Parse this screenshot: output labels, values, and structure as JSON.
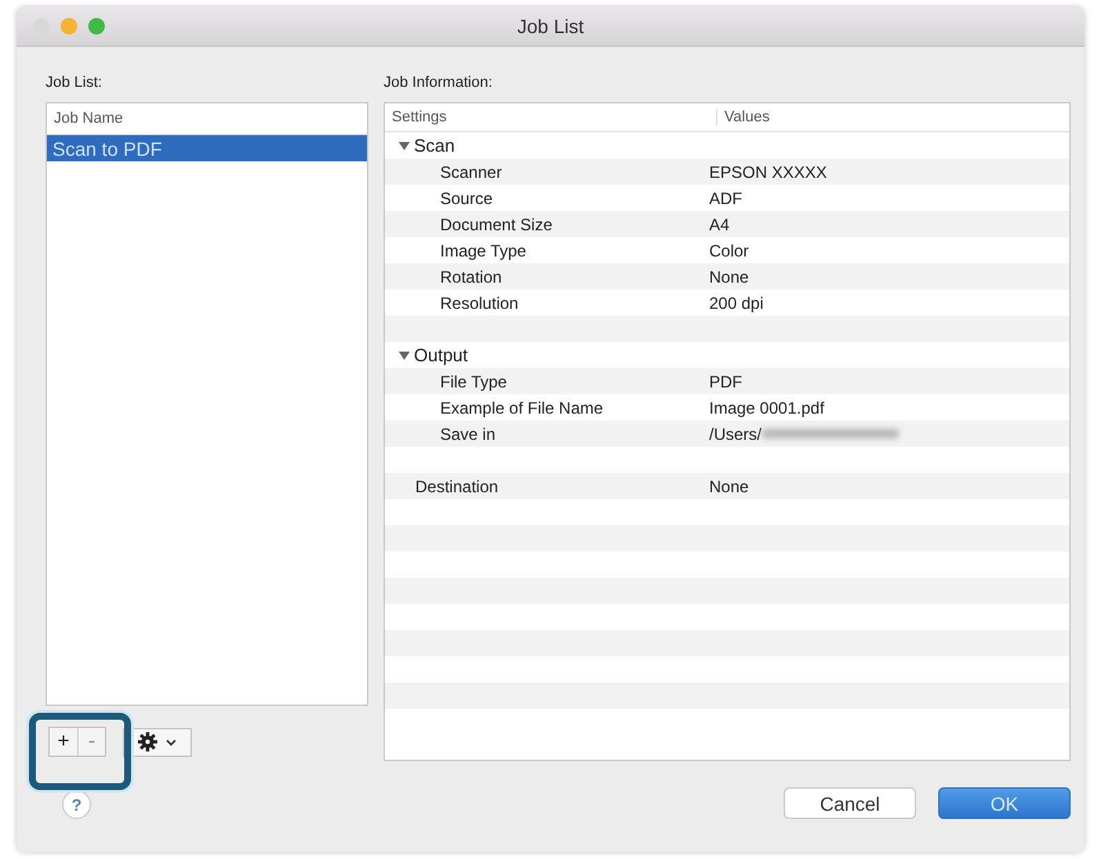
{
  "window": {
    "title": "Job List"
  },
  "job_list": {
    "label": "Job List:",
    "column": "Job Name",
    "items": [
      {
        "name": "Scan to PDF",
        "selected": true
      }
    ]
  },
  "job_information": {
    "label": "Job Information:",
    "columns": [
      "Settings",
      "Values"
    ],
    "rows": [
      {
        "setting": "Scan",
        "expanded": true,
        "children": [
          {
            "setting": "Scanner",
            "value": "EPSON XXXXX"
          },
          {
            "setting": "Source",
            "value": "ADF"
          },
          {
            "setting": "Document Size",
            "value": "A4"
          },
          {
            "setting": "Image Type",
            "value": "Color"
          },
          {
            "setting": "Rotation",
            "value": "None"
          },
          {
            "setting": "Resolution",
            "value": "200 dpi"
          }
        ]
      },
      {
        "setting": "Output",
        "expanded": true,
        "children": [
          {
            "setting": "File Type",
            "value": "PDF"
          },
          {
            "setting": "Example of File Name",
            "value": "Image 0001.pdf"
          },
          {
            "setting": "Save in",
            "value": "/Users/",
            "redacted": true
          }
        ]
      },
      {
        "setting": "Destination",
        "value": "None"
      }
    ]
  },
  "list_controls": {
    "add": "+",
    "remove": "-",
    "remove_disabled": true,
    "highlighted": true
  },
  "help": "?",
  "buttons": [
    {
      "label": "Cancel",
      "default": false
    },
    {
      "label": "OK",
      "default": true
    }
  ]
}
